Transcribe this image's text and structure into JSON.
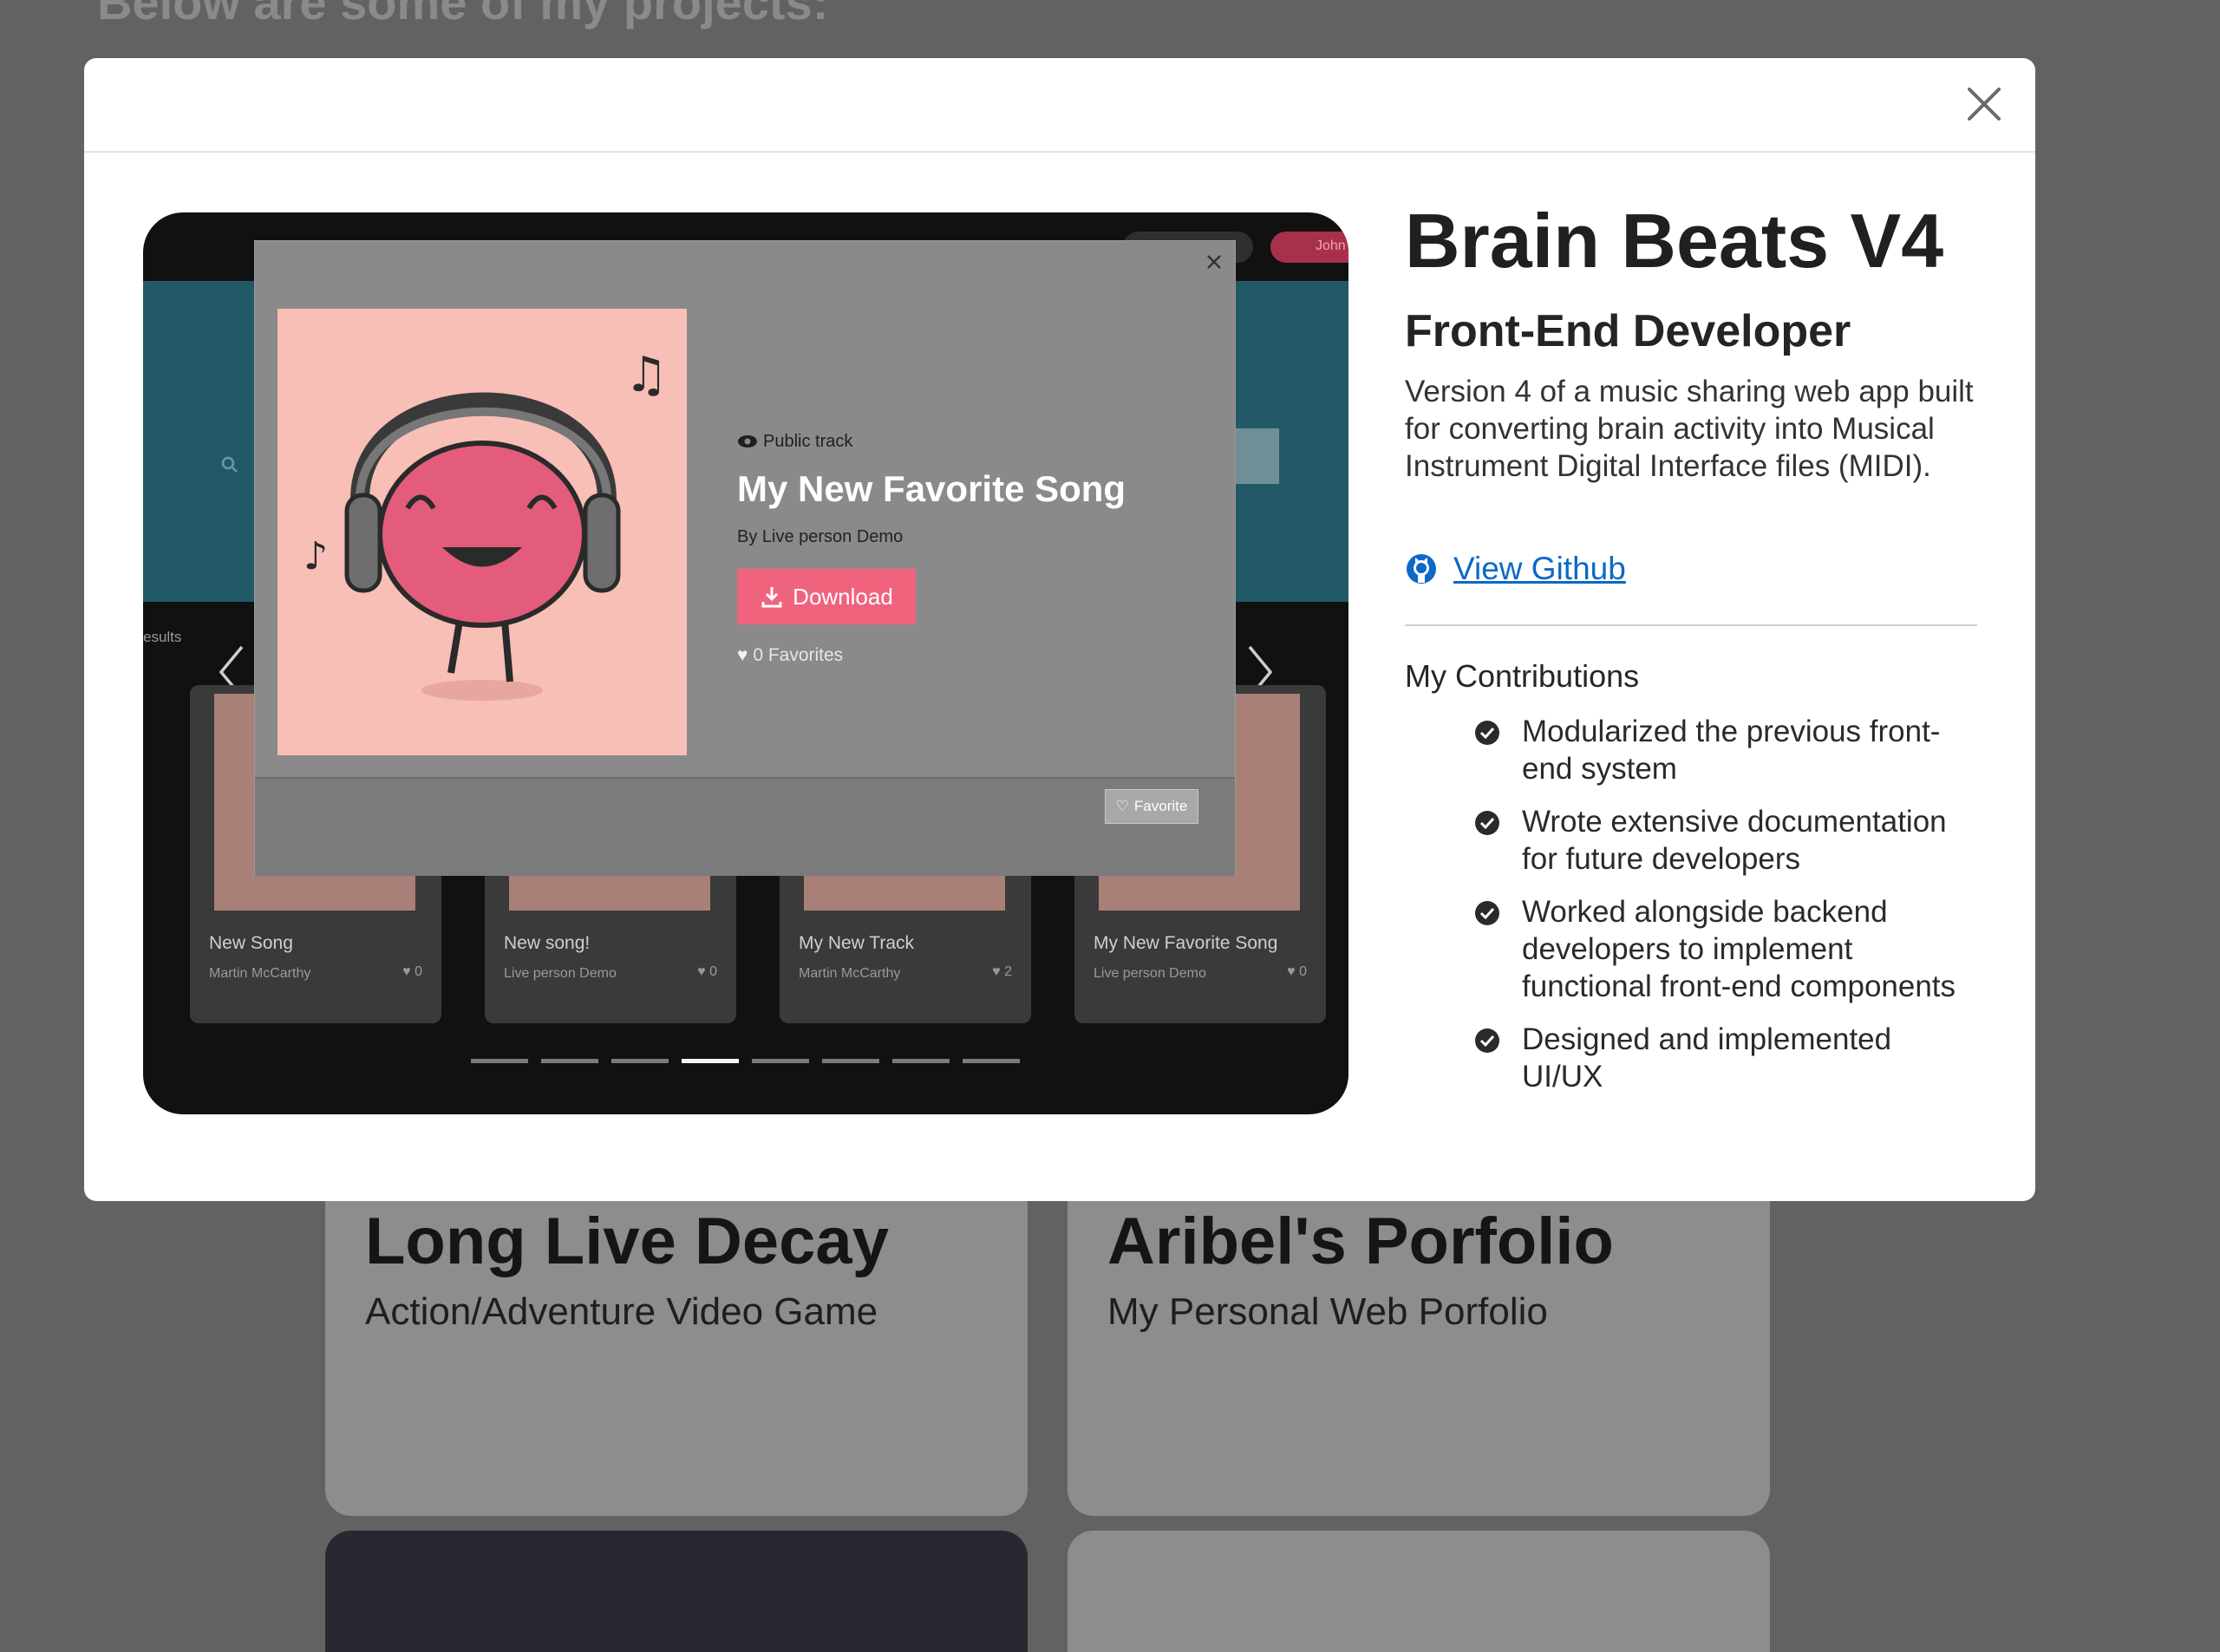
{
  "background": {
    "heading": "Below are some of my projects:",
    "cards": [
      {
        "title": "Long Live Decay",
        "subtitle": "Action/Adventure Video Game"
      },
      {
        "title": "Aribel's Porfolio",
        "subtitle": "My Personal Web Porfolio"
      }
    ]
  },
  "modal": {
    "close_icon": "close-icon",
    "project": {
      "title": "Brain Beats V4",
      "role": "Front-End Developer",
      "description": "Version 4 of a music sharing web app built for converting brain activity into Musical Instrument Digital Interface files (MIDI).",
      "github_label": "View Github",
      "contributions_heading": "My Contributions",
      "contributions": [
        "Modularized the previous front-end system",
        "Wrote extensive documentation for future developers",
        "Worked alongside backend developers to implement functional front-end components",
        "Designed and implemented UI/UX"
      ]
    },
    "screenshot": {
      "user_label": "John",
      "results_label": "esults",
      "popup": {
        "visibility": "Public track",
        "song_title": "My New Favorite Song",
        "byline": "By Live person Demo",
        "download_label": "Download",
        "favorites_count": "0 Favorites",
        "favorite_button": "Favorite"
      },
      "tracks": [
        {
          "title": "New Song",
          "artist": "Martin McCarthy",
          "favorites": "0"
        },
        {
          "title": "New song!",
          "artist": "Live person Demo",
          "favorites": "0"
        },
        {
          "title": "My New Track",
          "artist": "Martin McCarthy",
          "favorites": "2"
        },
        {
          "title": "My New Favorite Song",
          "artist": "Live person Demo",
          "favorites": "0"
        }
      ],
      "carousel_pages": 8,
      "carousel_active_page": 4
    }
  },
  "colors": {
    "accent_pink": "#f0637d",
    "link_blue": "#0b69c7",
    "teal": "#215a66"
  }
}
